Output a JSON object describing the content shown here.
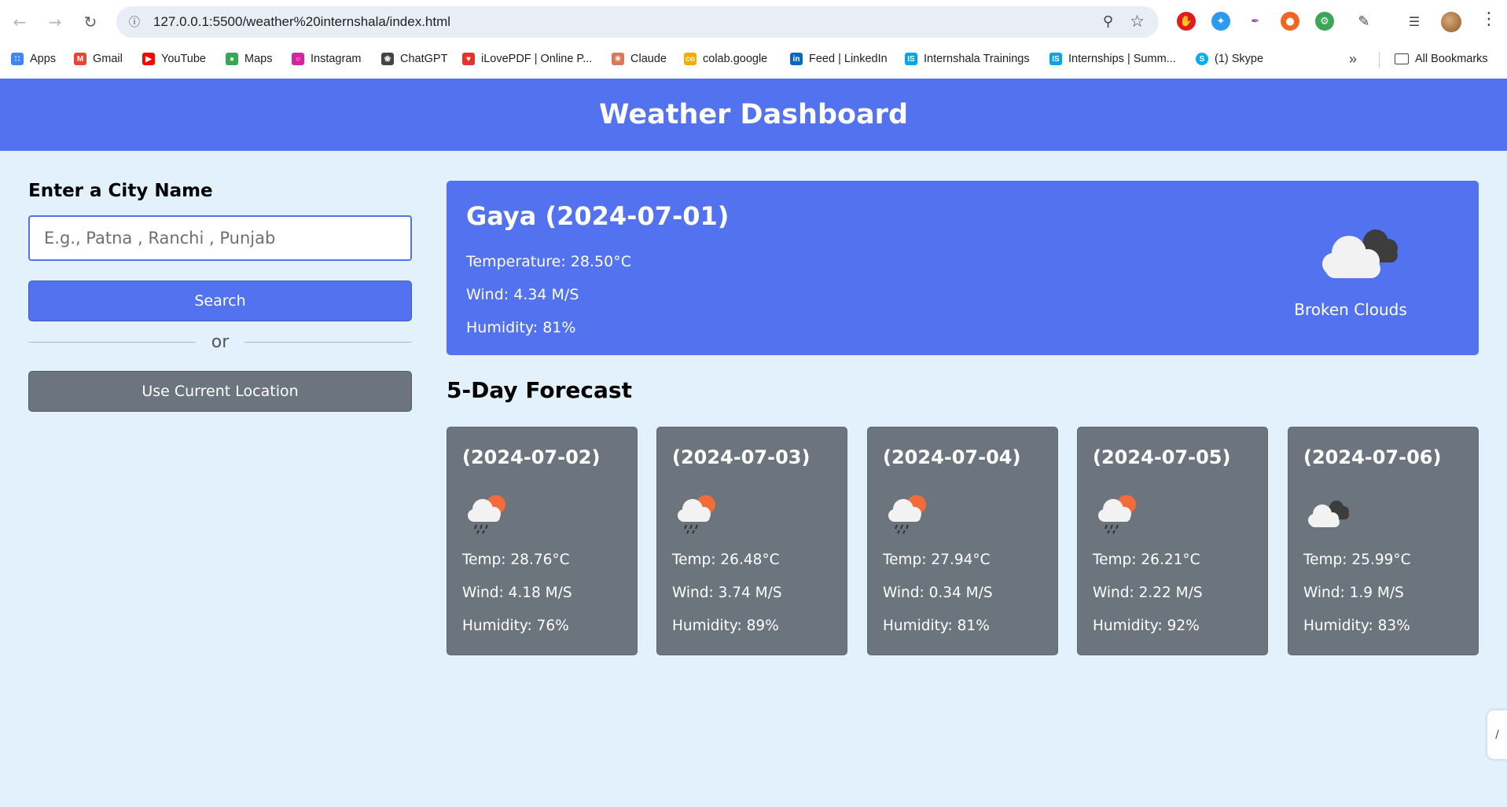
{
  "browser": {
    "url": "127.0.0.1:5500/weather%20internshala/index.html",
    "bookmarks": [
      {
        "label": "Apps",
        "icon": "apps-grid-icon",
        "color": "#4285f4"
      },
      {
        "label": "Gmail",
        "icon": "gmail-icon",
        "color": "#ea4335"
      },
      {
        "label": "YouTube",
        "icon": "youtube-icon",
        "color": "#ff0000"
      },
      {
        "label": "Maps",
        "icon": "maps-icon",
        "color": "#34a853"
      },
      {
        "label": "Instagram",
        "icon": "instagram-icon",
        "color": "#d6249f"
      },
      {
        "label": "ChatGPT",
        "icon": "chatgpt-icon",
        "color": "#444444"
      },
      {
        "label": "iLovePDF | Online P...",
        "icon": "ilovepdf-icon",
        "color": "#e5322d"
      },
      {
        "label": "Claude",
        "icon": "claude-icon",
        "color": "#d97757"
      },
      {
        "label": "colab.google",
        "icon": "colab-icon",
        "color": "#f9ab00"
      },
      {
        "label": "Feed | LinkedIn",
        "icon": "linkedin-icon",
        "color": "#0a66c2"
      },
      {
        "label": "Internshala Trainings",
        "icon": "internshala-trainings-icon",
        "color": "#00a5ec"
      },
      {
        "label": "Internships | Summ...",
        "icon": "internshala-icon",
        "color": "#00a5ec"
      },
      {
        "label": "(1) Skype",
        "icon": "skype-icon",
        "color": "#00aff0"
      }
    ],
    "all_bookmarks_label": "All Bookmarks"
  },
  "header": {
    "title": "Weather Dashboard"
  },
  "search": {
    "label": "Enter a City Name",
    "placeholder": "E.g., Patna , Ranchi , Punjab",
    "button": "Search",
    "divider": "or",
    "location_button": "Use Current Location"
  },
  "current": {
    "city": "Gaya (2024-07-01)",
    "temperature": "Temperature: 28.50°C",
    "wind": "Wind: 4.34 M/S",
    "humidity": "Humidity: 81%",
    "description": "Broken Clouds",
    "icon": "broken-clouds-icon"
  },
  "forecast": {
    "title": "5-Day Forecast",
    "days": [
      {
        "date": "(2024-07-02)",
        "temp": "Temp: 28.76°C",
        "wind": "Wind: 4.18 M/S",
        "humidity": "Humidity: 76%",
        "icon": "rain-sun-icon"
      },
      {
        "date": "(2024-07-03)",
        "temp": "Temp: 26.48°C",
        "wind": "Wind: 3.74 M/S",
        "humidity": "Humidity: 89%",
        "icon": "rain-sun-icon"
      },
      {
        "date": "(2024-07-04)",
        "temp": "Temp: 27.94°C",
        "wind": "Wind: 0.34 M/S",
        "humidity": "Humidity: 81%",
        "icon": "rain-sun-icon"
      },
      {
        "date": "(2024-07-05)",
        "temp": "Temp: 26.21°C",
        "wind": "Wind: 2.22 M/S",
        "humidity": "Humidity: 92%",
        "icon": "rain-sun-icon"
      },
      {
        "date": "(2024-07-06)",
        "temp": "Temp: 25.99°C",
        "wind": "Wind: 1.9 M/S",
        "humidity": "Humidity: 83%",
        "icon": "broken-clouds-icon"
      }
    ]
  },
  "colors": {
    "primary": "#5372f0",
    "secondary": "#6c757d",
    "background": "#e2f1fc"
  }
}
